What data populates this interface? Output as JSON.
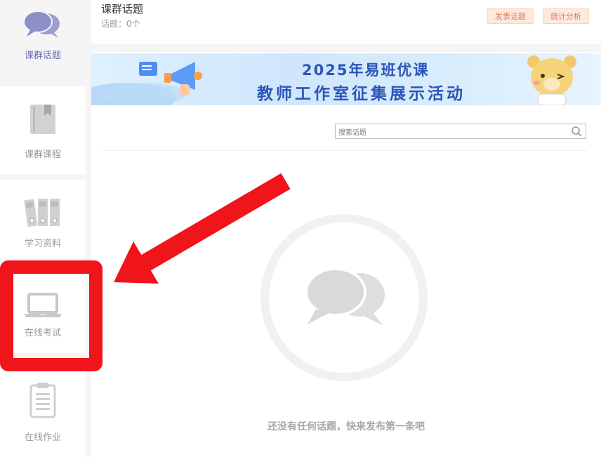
{
  "sidebar": {
    "items": [
      {
        "label": "课群话题",
        "icon": "chat-bubbles-icon",
        "active": true
      },
      {
        "label": "课群课程",
        "icon": "book-icon"
      },
      {
        "label": "学习资料",
        "icon": "binders-icon"
      },
      {
        "label": "在线考试",
        "icon": "laptop-icon"
      },
      {
        "label": "在线作业",
        "icon": "clipboard-icon"
      }
    ]
  },
  "header": {
    "title": "课群话题",
    "topic_count": "话题：0个",
    "post_button": "发表话题",
    "stats_button": "统计分析"
  },
  "banner": {
    "line1": "2025年易班优课",
    "line2": "教师工作室征集展示活动"
  },
  "search": {
    "placeholder": "搜索话题",
    "icon": "search-icon"
  },
  "empty_state": {
    "icon": "chat-bubbles-icon",
    "text": "还没有任何话题，快来发布第一条吧"
  },
  "annotation": {
    "color": "#f0141b",
    "target": "在线考试"
  },
  "colors": {
    "accent": "#6a6fb0",
    "button_bg": "#fde9dd",
    "button_text": "#e07a5c",
    "banner_text": "#2b56b8"
  }
}
